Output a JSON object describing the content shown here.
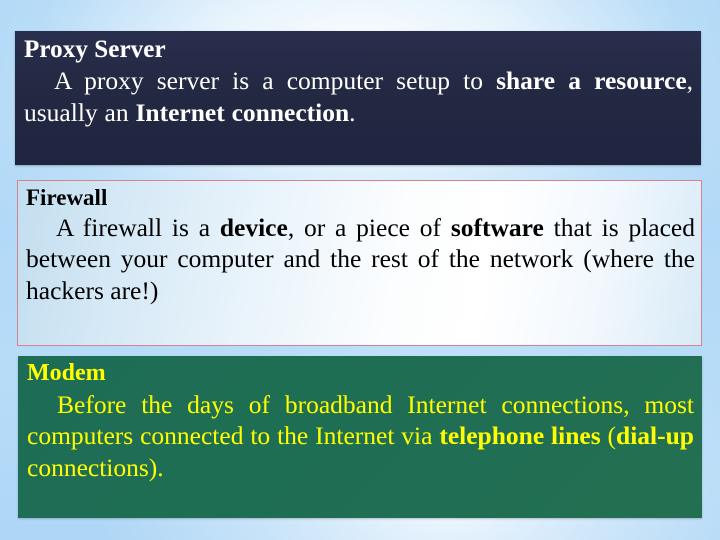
{
  "slide": {
    "background_colors": {
      "edge_blue": "#aed6f6",
      "center_white": "#ffffff"
    }
  },
  "cards": [
    {
      "id": "proxy-server",
      "heading": "Proxy Server",
      "body_plain": "A proxy server is a computer setup to share a resource, usually an Internet connection.",
      "body_runs": [
        {
          "text": "A proxy server is a computer setup to ",
          "bold": false
        },
        {
          "text": "share a resource",
          "bold": true
        },
        {
          "text": ", usually an ",
          "bold": false
        },
        {
          "text": "Internet connection",
          "bold": true
        },
        {
          "text": ".",
          "bold": false
        }
      ],
      "background_color": "#232942",
      "text_color": "#ffffff",
      "border_color": "none"
    },
    {
      "id": "firewall",
      "heading": "Firewall",
      "body_plain": "A firewall is a device, or a piece of software that is placed between your computer and the rest of the network (where the hackers are!)",
      "body_runs": [
        {
          "text": "A firewall is a ",
          "bold": false
        },
        {
          "text": "device",
          "bold": true
        },
        {
          "text": ", or a piece of ",
          "bold": false
        },
        {
          "text": "software",
          "bold": true
        },
        {
          "text": " that is placed between your computer and the rest of the network (where the hackers are!)",
          "bold": false
        }
      ],
      "background_color": "#eef7fc",
      "text_color": "#000000",
      "border_color": "#d4838f"
    },
    {
      "id": "modem",
      "heading": "Modem",
      "body_plain": "Before the days of broadband Internet connections, most computers connected to the Internet via telephone lines (dial-up connections).",
      "body_runs": [
        {
          "text": "Before the days of broadband Internet connections, most computers connected to the Internet via ",
          "bold": false
        },
        {
          "text": "telephone lines",
          "bold": true
        },
        {
          "text": " (",
          "bold": false
        },
        {
          "text": "dial-up",
          "bold": true
        },
        {
          "text": " connections).",
          "bold": false
        }
      ],
      "background_color": "#1e6e54",
      "text_color": "#ffff00",
      "border_color": "none"
    }
  ]
}
